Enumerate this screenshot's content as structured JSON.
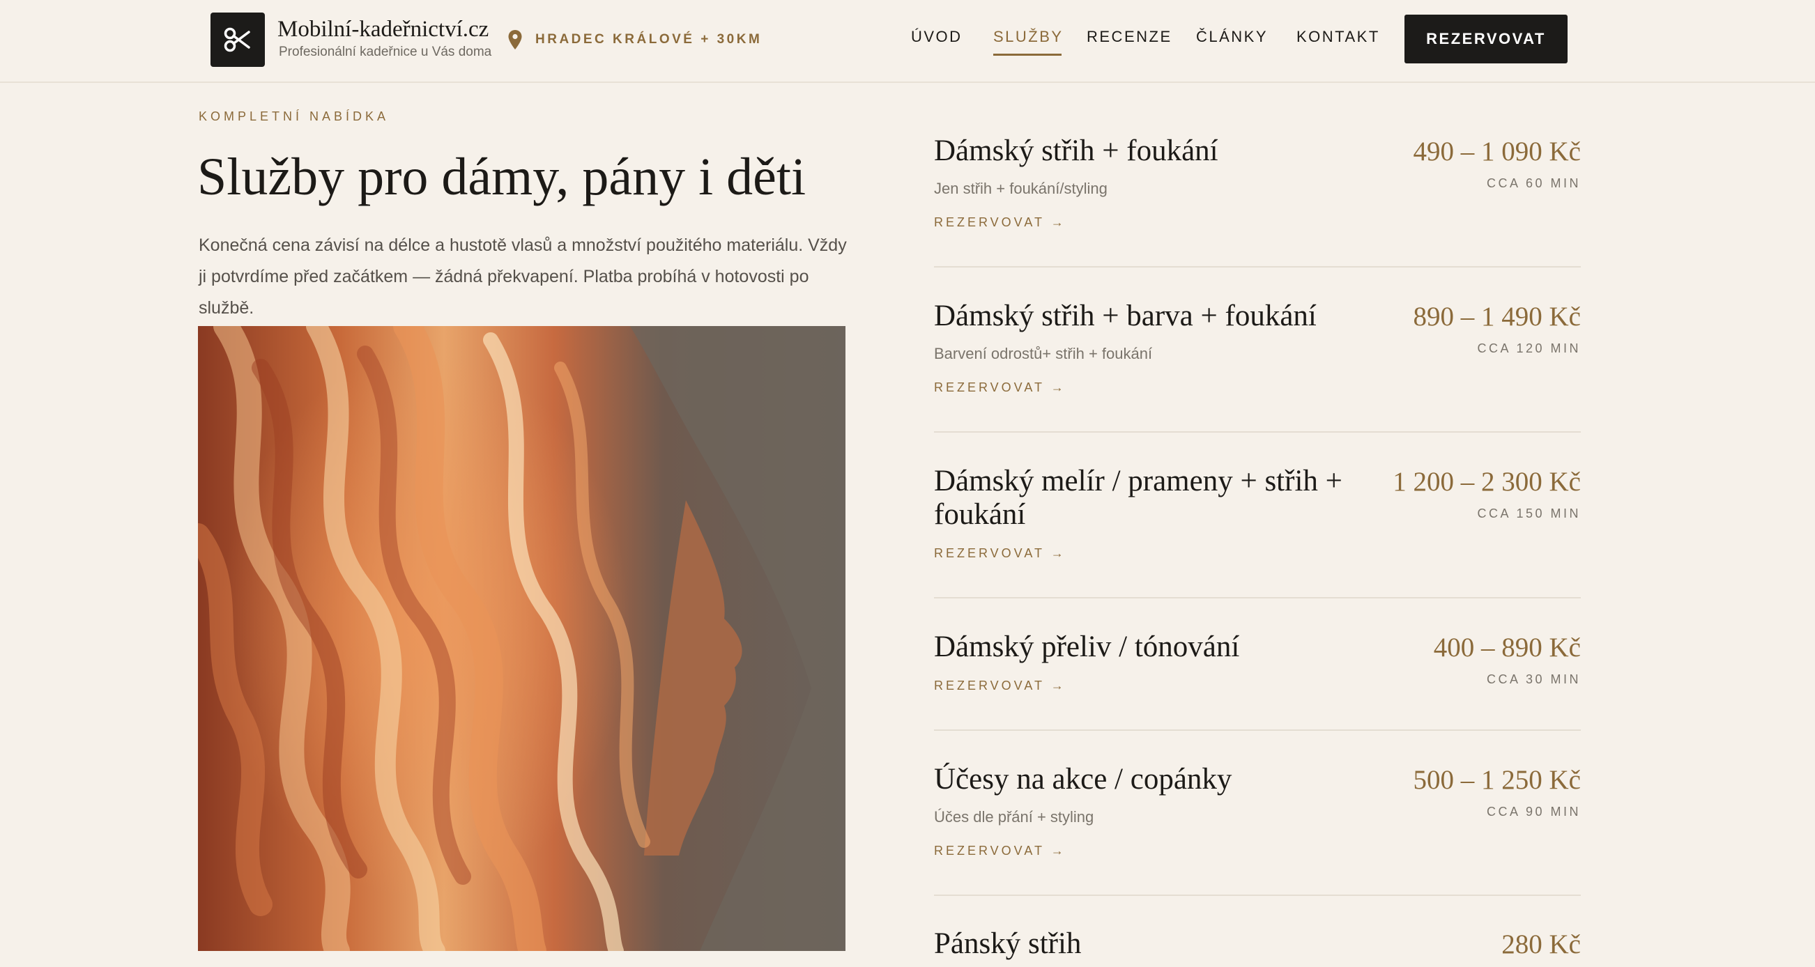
{
  "header": {
    "brand_name": "Mobilní-kadeřnictví.cz",
    "brand_tagline": "Profesionální kadeřnice u Vás doma",
    "location": "HRADEC KRÁLOVÉ + 30KM",
    "nav": [
      "ÚVOD",
      "SLUŽBY",
      "RECENZE",
      "ČLÁNKY",
      "KONTAKT"
    ],
    "active_nav": "SLUŽBY",
    "cta": "REZERVOVAT"
  },
  "intro": {
    "eyebrow": "KOMPLETNÍ NABÍDKA",
    "title": "Služby pro dámy, pány i děti",
    "text": "Konečná cena závisí na délce a hustotě vlasů a množství použitého materiálu. Vždy ji potvrdíme před začátkem — žádná překvapení. Platba probíhá v hotovosti po službě."
  },
  "services": [
    {
      "name": "Dámský střih + foukání",
      "price": "490 – 1 090 Kč",
      "duration": "CCA 60 MIN",
      "description": "Jen střih + foukání/styling",
      "link": "REZERVOVAT →"
    },
    {
      "name": "Dámský střih + barva + foukání",
      "price": "890 – 1 490 Kč",
      "duration": "CCA 120 MIN",
      "description": "Barvení odrostů+ střih + foukání",
      "link": "REZERVOVAT →"
    },
    {
      "name": "Dámský melír / prameny + střih + foukání",
      "price": "1 200 – 2 300 Kč",
      "duration": "CCA 150 MIN",
      "description": "",
      "link": "REZERVOVAT →"
    },
    {
      "name": "Dámský přeliv / tónování",
      "price": "400 – 890 Kč",
      "duration": "CCA 30 MIN",
      "description": "",
      "link": "REZERVOVAT →"
    },
    {
      "name": "Účesy na akce / copánky",
      "price": "500 – 1 250 Kč",
      "duration": "CCA 90 MIN",
      "description": "Účes dle přání + styling",
      "link": "REZERVOVAT →"
    },
    {
      "name": "Pánský střih",
      "price": "280 Kč"
    }
  ],
  "icons": {
    "logo": "scissors-icon",
    "location": "map-pin-icon"
  },
  "colors": {
    "accent": "#8b6a3a",
    "dark": "#1c1b19",
    "background": "#f6f1ea"
  }
}
